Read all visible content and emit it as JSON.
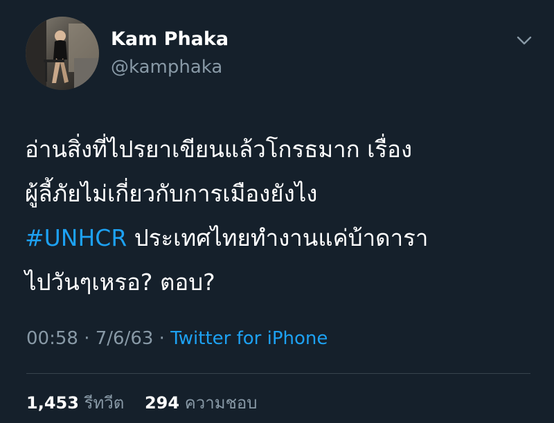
{
  "author": {
    "display_name": "Kam Phaka",
    "handle": "@kamphaka",
    "avatar_icon": "profile-photo"
  },
  "tweet": {
    "line1": "อ่านสิ่งที่ไปรยาเขียนแล้วโกรธมาก เรื่อง",
    "line2": "ผู้ลี้ภัยไม่เกี่ยวกับการเมืองยังไง",
    "hashtag": "#UNHCR",
    "line3_rest": " ประเทศไทยทำงานแค่บ้าดารา",
    "line4": "ไปวันๆเหรอ? ตอบ?"
  },
  "meta": {
    "time": "00:58",
    "date": "7/6/63",
    "separator": " · ",
    "source": "Twitter for iPhone"
  },
  "stats": {
    "retweets_count": "1,453",
    "retweets_label": "รีทวีต",
    "likes_count": "294",
    "likes_label": "ความชอบ"
  },
  "colors": {
    "background": "#15202b",
    "text": "#ffffff",
    "secondary": "#8899a6",
    "accent": "#1da1f2",
    "divider": "#38444d"
  },
  "icons": {
    "menu": "chevron-down-icon"
  }
}
